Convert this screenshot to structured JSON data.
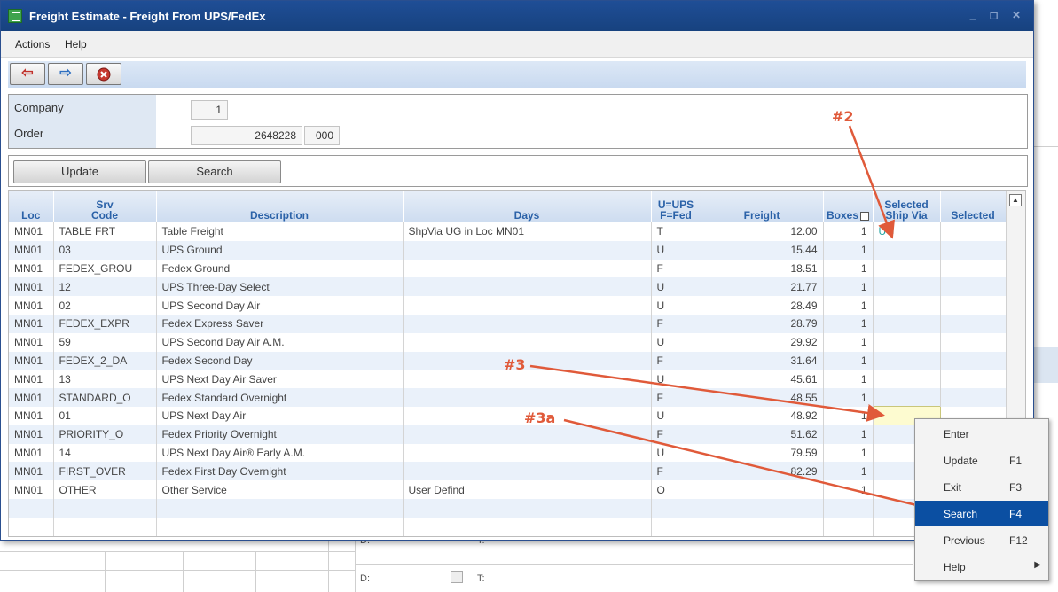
{
  "window": {
    "title": "Freight Estimate - Freight From UPS/FedEx",
    "controls": "_ ◻ ✕"
  },
  "menu": {
    "actions": "Actions",
    "help": "Help"
  },
  "toolbar": {
    "back_icon": "red-left-arrow",
    "forward_icon": "blue-right-arrow",
    "close_icon": "red-x-circle"
  },
  "form": {
    "company_label": "Company",
    "company_value": "1",
    "order_label": "Order",
    "order_value": "2648228",
    "order_suffix": "000"
  },
  "buttons": {
    "update": "Update",
    "search": "Search"
  },
  "grid": {
    "headers": {
      "loc": "Loc",
      "srv_code_1": "Srv",
      "srv_code_2": "Code",
      "description": "Description",
      "days": "Days",
      "carrier_1": "U=UPS",
      "carrier_2": "F=Fed",
      "freight": "Freight",
      "boxes": "Boxes",
      "selected_ship_via_1": "Selected",
      "selected_ship_via_2": "Ship Via",
      "selected": "Selected"
    },
    "rows": [
      {
        "loc": "MN01",
        "code": "TABLE FRT",
        "desc": "Table Freight",
        "days": "ShpVia UG   in Loc MN01",
        "carrier": "T",
        "freight": "12.00",
        "boxes": "1",
        "shipvia": "UG",
        "selected": ""
      },
      {
        "loc": "MN01",
        "code": "03",
        "desc": "UPS Ground",
        "days": "",
        "carrier": "U",
        "freight": "15.44",
        "boxes": "1",
        "shipvia": "",
        "selected": ""
      },
      {
        "loc": "MN01",
        "code": "FEDEX_GROU",
        "desc": "Fedex Ground",
        "days": "",
        "carrier": "F",
        "freight": "18.51",
        "boxes": "1",
        "shipvia": "",
        "selected": ""
      },
      {
        "loc": "MN01",
        "code": "12",
        "desc": "UPS Three-Day Select",
        "days": "",
        "carrier": "U",
        "freight": "21.77",
        "boxes": "1",
        "shipvia": "",
        "selected": ""
      },
      {
        "loc": "MN01",
        "code": "02",
        "desc": "UPS Second Day Air",
        "days": "",
        "carrier": "U",
        "freight": "28.49",
        "boxes": "1",
        "shipvia": "",
        "selected": ""
      },
      {
        "loc": "MN01",
        "code": "FEDEX_EXPR",
        "desc": "Fedex Express Saver",
        "days": "",
        "carrier": "F",
        "freight": "28.79",
        "boxes": "1",
        "shipvia": "",
        "selected": ""
      },
      {
        "loc": "MN01",
        "code": "59",
        "desc": "UPS Second Day Air A.M.",
        "days": "",
        "carrier": "U",
        "freight": "29.92",
        "boxes": "1",
        "shipvia": "",
        "selected": ""
      },
      {
        "loc": "MN01",
        "code": "FEDEX_2_DA",
        "desc": "Fedex Second Day",
        "days": "",
        "carrier": "F",
        "freight": "31.64",
        "boxes": "1",
        "shipvia": "",
        "selected": ""
      },
      {
        "loc": "MN01",
        "code": "13",
        "desc": "UPS Next Day Air Saver",
        "days": "",
        "carrier": "U",
        "freight": "45.61",
        "boxes": "1",
        "shipvia": "",
        "selected": ""
      },
      {
        "loc": "MN01",
        "code": "STANDARD_O",
        "desc": "Fedex Standard Overnight",
        "days": "",
        "carrier": "F",
        "freight": "48.55",
        "boxes": "1",
        "shipvia": "",
        "selected": ""
      },
      {
        "loc": "MN01",
        "code": "01",
        "desc": "UPS Next Day Air",
        "days": "",
        "carrier": "U",
        "freight": "48.92",
        "boxes": "1",
        "shipvia": "",
        "selected": ""
      },
      {
        "loc": "MN01",
        "code": "PRIORITY_O",
        "desc": "Fedex Priority Overnight",
        "days": "",
        "carrier": "F",
        "freight": "51.62",
        "boxes": "1",
        "shipvia": "",
        "selected": ""
      },
      {
        "loc": "MN01",
        "code": "14",
        "desc": "UPS Next Day Air® Early A.M.",
        "days": "",
        "carrier": "U",
        "freight": "79.59",
        "boxes": "1",
        "shipvia": "",
        "selected": ""
      },
      {
        "loc": "MN01",
        "code": "FIRST_OVER",
        "desc": "Fedex First Day Overnight",
        "days": "",
        "carrier": "F",
        "freight": "82.29",
        "boxes": "1",
        "shipvia": "",
        "selected": ""
      },
      {
        "loc": "MN01",
        "code": "OTHER",
        "desc": "Other Service",
        "days": "User Defind",
        "carrier": "O",
        "freight": "",
        "boxes": "1",
        "shipvia": "",
        "selected": ""
      },
      {
        "loc": "",
        "code": "",
        "desc": "",
        "days": "",
        "carrier": "",
        "freight": "",
        "boxes": "",
        "shipvia": "",
        "selected": ""
      },
      {
        "loc": "",
        "code": "",
        "desc": "",
        "days": "",
        "carrier": "",
        "freight": "",
        "boxes": "",
        "shipvia": "",
        "selected": ""
      }
    ]
  },
  "annotations": {
    "a2": "#2",
    "a3": "#3",
    "a3a": "#3a"
  },
  "context_menu": {
    "items": [
      {
        "label": "Enter",
        "key": ""
      },
      {
        "label": "Update",
        "key": "F1"
      },
      {
        "label": "Exit",
        "key": "F3"
      },
      {
        "label": "Search",
        "key": "F4"
      },
      {
        "label": "Previous",
        "key": "F12"
      },
      {
        "label": "Help",
        "key": ""
      }
    ],
    "active_index": 3
  },
  "background": {
    "d_label": "D:",
    "t_label": "T:",
    "d_label_2": "D:",
    "t_label_2": "T:"
  },
  "colors": {
    "title_bar": "#1f4e96",
    "header_text": "#2b62a8",
    "menu_highlight": "#0b4fa2",
    "annotation": "#e05a3a",
    "ship_via_text": "#1fa3a0"
  }
}
